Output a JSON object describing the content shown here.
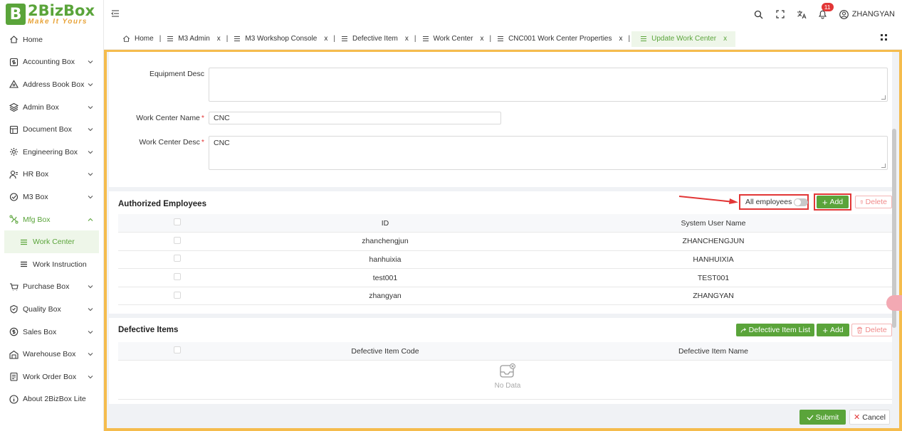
{
  "app": {
    "logo_letter": "B",
    "logo_title": "2BizBox",
    "logo_subtitle": "Make It Yours"
  },
  "sidebar": {
    "items": [
      {
        "label": "Home",
        "icon": "home-icon",
        "has_chevron": false
      },
      {
        "label": "Accounting Box",
        "icon": "dollar-doc-icon",
        "has_chevron": true
      },
      {
        "label": "Address Book Box",
        "icon": "address-icon",
        "has_chevron": true
      },
      {
        "label": "Admin Box",
        "icon": "layers-icon",
        "has_chevron": true
      },
      {
        "label": "Document Box",
        "icon": "document-icon",
        "has_chevron": true
      },
      {
        "label": "Engineering Box",
        "icon": "gear-icon",
        "has_chevron": true
      },
      {
        "label": "HR Box",
        "icon": "person-icon",
        "has_chevron": true
      },
      {
        "label": "M3 Box",
        "icon": "m3-icon",
        "has_chevron": true
      },
      {
        "label": "Mfg Box",
        "icon": "mfg-icon",
        "has_chevron": true,
        "expanded": true
      },
      {
        "label": "Work Center",
        "sub": true,
        "active": true
      },
      {
        "label": "Work Instruction",
        "sub": true
      },
      {
        "label": "Purchase Box",
        "icon": "cart-icon",
        "has_chevron": true
      },
      {
        "label": "Quality Box",
        "icon": "shield-icon",
        "has_chevron": true
      },
      {
        "label": "Sales Box",
        "icon": "sales-icon",
        "has_chevron": true
      },
      {
        "label": "Warehouse Box",
        "icon": "warehouse-icon",
        "has_chevron": true
      },
      {
        "label": "Work Order Box",
        "icon": "workorder-icon",
        "has_chevron": true
      },
      {
        "label": "About 2BizBox Lite",
        "icon": "info-icon",
        "has_chevron": false
      }
    ]
  },
  "header": {
    "notification_count": "11",
    "username": "ZHANGYAN"
  },
  "tabs": [
    {
      "label": "Home",
      "icon": "home",
      "closable": false
    },
    {
      "label": "M3 Admin",
      "closable": true
    },
    {
      "label": "M3 Workshop Console",
      "closable": true
    },
    {
      "label": "Defective Item",
      "closable": true
    },
    {
      "label": "Work Center",
      "closable": true
    },
    {
      "label": "CNC001 Work Center Properties",
      "closable": true
    },
    {
      "label": "Update Work Center",
      "closable": true,
      "active": true
    }
  ],
  "tab_close_glyph": "x",
  "form": {
    "equipment_desc_label": "Equipment Desc",
    "equipment_desc_value": "",
    "wc_name_label": "Work Center Name",
    "wc_name_value": "CNC",
    "wc_desc_label": "Work Center Desc",
    "wc_desc_value": "CNC",
    "required_mark": "*"
  },
  "authorized": {
    "title": "Authorized Employees",
    "toggle_label": "All employees",
    "toggle_on": false,
    "add_label": "Add",
    "delete_label": "Delete",
    "columns": [
      "ID",
      "System User Name"
    ],
    "rows": [
      [
        "zhanchengjun",
        "ZHANCHENGJUN"
      ],
      [
        "hanhuixia",
        "HANHUIXIA"
      ],
      [
        "test001",
        "TEST001"
      ],
      [
        "zhangyan",
        "ZHANGYAN"
      ]
    ]
  },
  "defective": {
    "title": "Defective Items",
    "list_label": "Defective Item List",
    "add_label": "Add",
    "delete_label": "Delete",
    "columns": [
      "Defective Item Code",
      "Defective Item Name"
    ],
    "empty_text": "No Data"
  },
  "footer": {
    "submit_label": "Submit",
    "cancel_label": "Cancel"
  },
  "colors": {
    "accent": "#5aa43a",
    "frame": "#f5bc4d",
    "danger": "#e23636"
  }
}
